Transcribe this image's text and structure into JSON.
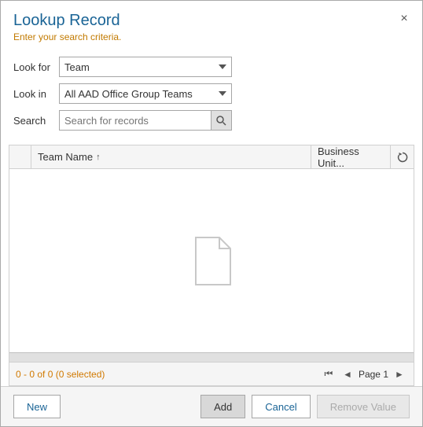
{
  "dialog": {
    "title": "Lookup Record",
    "subtitle": "Enter your search criteria.",
    "close_label": "×"
  },
  "form": {
    "look_for_label": "Look for",
    "look_for_value": "Team",
    "look_in_label": "Look in",
    "look_in_value": "All AAD Office Group Teams",
    "search_label": "Search",
    "search_placeholder": "Search for records",
    "look_for_options": [
      "Team"
    ],
    "look_in_options": [
      "All AAD Office Group Teams"
    ]
  },
  "grid": {
    "col_team_name": "Team Name",
    "col_business_unit": "Business Unit...",
    "sort_arrow": "↑",
    "empty_message": "",
    "record_count": "0 - 0 of 0 (0 selected)",
    "page_label": "Page 1"
  },
  "footer": {
    "new_label": "New",
    "add_label": "Add",
    "cancel_label": "Cancel",
    "remove_value_label": "Remove Value"
  }
}
